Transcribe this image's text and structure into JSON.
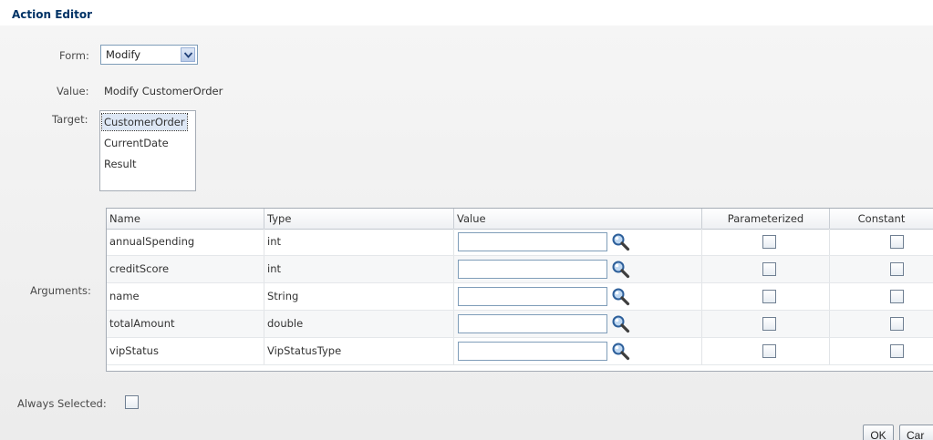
{
  "title": "Action Editor",
  "form": {
    "label": "Form:",
    "selected": "Modify"
  },
  "value": {
    "label": "Value:",
    "text": "Modify CustomerOrder"
  },
  "target": {
    "label": "Target:",
    "items": [
      "CustomerOrder",
      "CurrentDate",
      "Result"
    ],
    "selected_index": 0
  },
  "arguments": {
    "label": "Arguments:",
    "columns": [
      "Name",
      "Type",
      "Value",
      "Parameterized",
      "Constant"
    ],
    "rows": [
      {
        "name": "annualSpending",
        "type": "int",
        "value": "",
        "parameterized": false,
        "constant": false
      },
      {
        "name": "creditScore",
        "type": "int",
        "value": "",
        "parameterized": false,
        "constant": false
      },
      {
        "name": "name",
        "type": "String",
        "value": "",
        "parameterized": false,
        "constant": false
      },
      {
        "name": "totalAmount",
        "type": "double",
        "value": "",
        "parameterized": false,
        "constant": false
      },
      {
        "name": "vipStatus",
        "type": "VipStatusType",
        "value": "",
        "parameterized": false,
        "constant": false
      }
    ]
  },
  "always_selected": {
    "label": "Always Selected:",
    "checked": false
  },
  "buttons": {
    "ok": "OK",
    "cancel": "Car"
  },
  "icons": {
    "lookup": "magnifier-icon",
    "dropdown": "chevron-down-icon"
  },
  "colors": {
    "title": "#003366",
    "input_border": "#7f9db9",
    "selection": "#dde7f5"
  }
}
